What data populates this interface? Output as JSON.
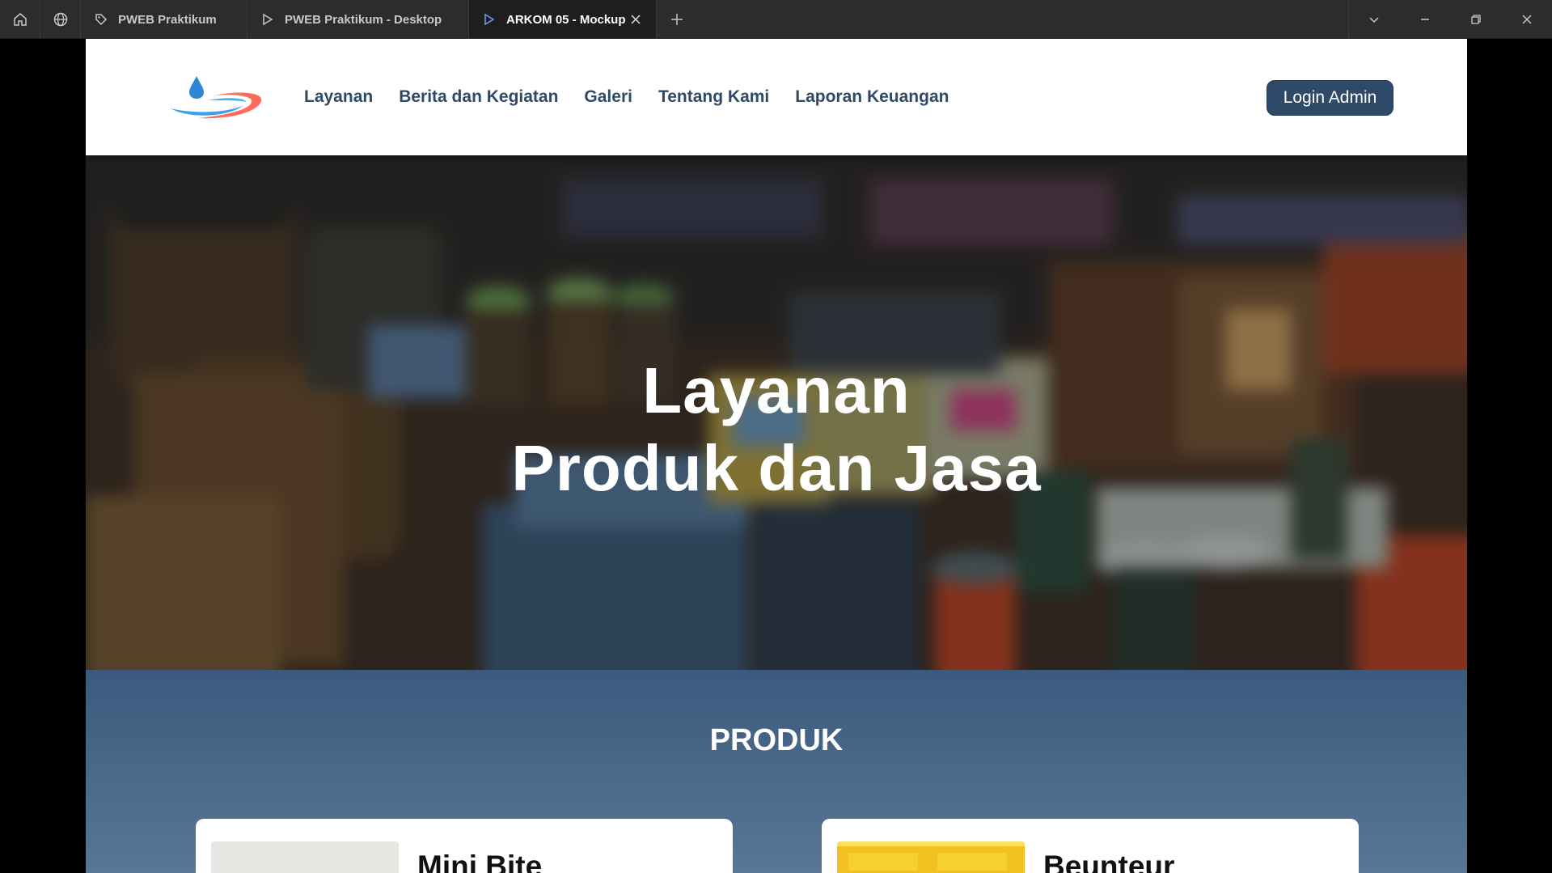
{
  "browser": {
    "tabs": [
      {
        "label": "PWEB Praktikum",
        "icon": "tag-icon",
        "active": false
      },
      {
        "label": "PWEB Praktikum - Desktop",
        "icon": "play-icon",
        "active": false
      },
      {
        "label": "ARKOM 05 - Mockup",
        "icon": "play-icon",
        "active": true
      }
    ]
  },
  "navbar": {
    "links": [
      "Layanan",
      "Berita dan Kegiatan",
      "Galeri",
      "Tentang Kami",
      "Laporan Keuangan"
    ],
    "login_label": "Login Admin"
  },
  "hero": {
    "line1": "Layanan",
    "line2": "Produk dan Jasa"
  },
  "produk": {
    "title": "PRODUK",
    "cards": [
      {
        "name": "Mini Bite"
      },
      {
        "name": "Beunteur"
      }
    ]
  },
  "colors": {
    "navy": "#2e4a68",
    "titlebar": "#2c2c2c",
    "section_top": "#3b5a7d"
  }
}
